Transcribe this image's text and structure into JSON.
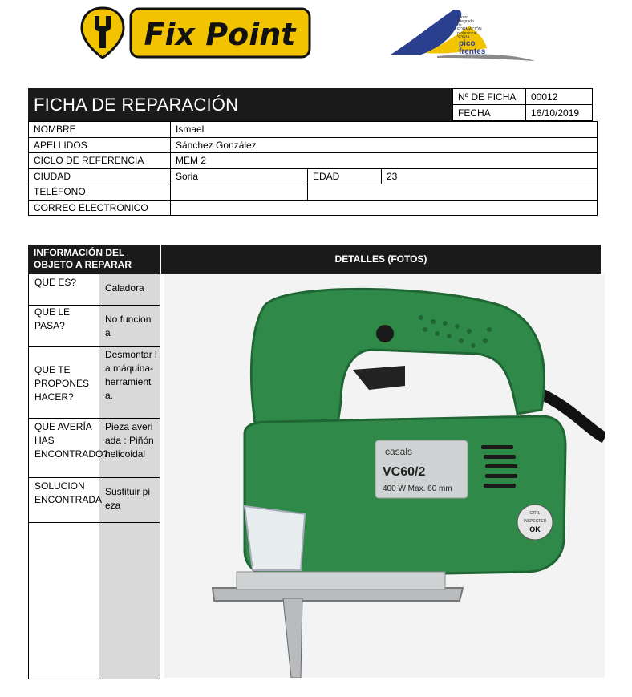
{
  "header": {
    "brand_name": "Fix Point",
    "school_lines": [
      "centro",
      "integrado",
      "de",
      "FORMACIÓN",
      "profesional"
    ],
    "school_brand_1": "pico",
    "school_brand_2": "frentes",
    "school_small": "SORIA"
  },
  "form": {
    "title": "FICHA DE REPARACIÓN",
    "ficha_label": "Nº DE FICHA",
    "ficha_value": "00012",
    "fecha_label": "FECHA",
    "fecha_value": "16/10/2019",
    "nombre_label": "NOMBRE",
    "nombre_value": "Ismael",
    "apellidos_label": "APELLIDOS",
    "apellidos_value": "Sánchez González",
    "ciclo_label": "CICLO DE REFERENCIA",
    "ciclo_value": "MEM 2",
    "ciudad_label": "CIUDAD",
    "ciudad_value": "Soria",
    "edad_label": "EDAD",
    "edad_value": "23",
    "telefono_label": "TELÉFONO",
    "telefono_value": "",
    "correo_label": "CORREO ELECTRONICO",
    "correo_value": ""
  },
  "repair": {
    "info_header": "INFORMACIÓN DEL OBJETO A REPARAR",
    "details_header": "DETALLES (FOTOS)",
    "rows": [
      {
        "question": "QUE ES?",
        "answer": "Caladora"
      },
      {
        "question": "QUE LE PASA?",
        "answer": "No funciona"
      },
      {
        "question": "QUE TE PROPONES HACER?",
        "answer": "Desmontar la máquina-herramienta."
      },
      {
        "question": "QUE AVERÍA HAS ENCONTRADO?",
        "answer": "Pieza averiada : Piñón helicoidal"
      },
      {
        "question": "SOLUCION ENCONTRADA",
        "answer": "Sustituir pieza"
      }
    ]
  },
  "photo": {
    "brand": "casals",
    "model": "VC60/2",
    "spec": "400 W   Max. 60 mm",
    "sticker_top": "CTRL",
    "sticker_mid": "INSPECTED",
    "sticker_ok": "OK",
    "colors": {
      "body": "#2f8a4a",
      "body_dark": "#1f6634",
      "plate": "#cfd3d4",
      "blade": "#b9bcbf"
    }
  }
}
